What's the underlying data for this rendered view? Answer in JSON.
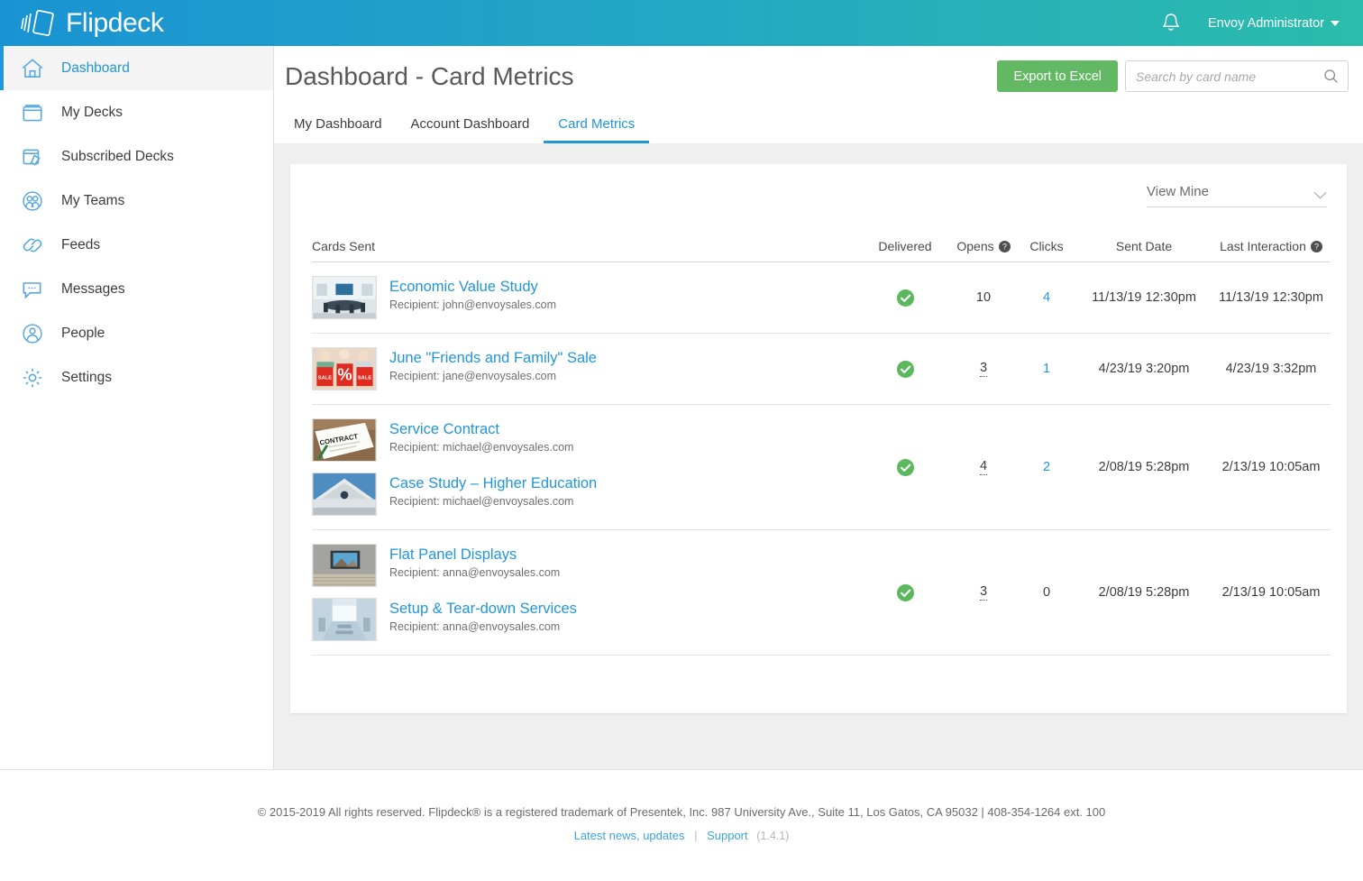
{
  "app": {
    "brand": "Flipdeck",
    "user": "Envoy Administrator",
    "bell_icon": "bell-icon",
    "logo_icon": "flipdeck-cards-logo"
  },
  "sidebar": {
    "items": [
      {
        "label": "Dashboard",
        "icon": "home-icon",
        "active": true
      },
      {
        "label": "My Decks",
        "icon": "deck-box-icon",
        "active": false
      },
      {
        "label": "Subscribed Decks",
        "icon": "subscribed-deck-icon",
        "active": false
      },
      {
        "label": "My Teams",
        "icon": "team-icon",
        "active": false
      },
      {
        "label": "Feeds",
        "icon": "link-chain-icon",
        "active": false
      },
      {
        "label": "Messages",
        "icon": "message-bubble-icon",
        "active": false
      },
      {
        "label": "People",
        "icon": "person-icon",
        "active": false
      },
      {
        "label": "Settings",
        "icon": "gear-icon",
        "active": false
      }
    ]
  },
  "page": {
    "title": "Dashboard - Card Metrics",
    "export_label": "Export to Excel",
    "search_placeholder": "Search by card name",
    "search_value": ""
  },
  "tabs": [
    {
      "label": "My Dashboard",
      "active": false
    },
    {
      "label": "Account Dashboard",
      "active": false
    },
    {
      "label": "Card Metrics",
      "active": true
    }
  ],
  "filter": {
    "view_label": "View Mine",
    "chevron_icon": "chevron-down-icon"
  },
  "table": {
    "headers": {
      "cards_sent": "Cards Sent",
      "delivered": "Delivered",
      "opens": "Opens",
      "clicks": "Clicks",
      "sent_date": "Sent Date",
      "last_interaction": "Last Interaction"
    },
    "groups": [
      {
        "cards": [
          {
            "title": "Economic Value Study",
            "recipient": "Recipient: john@envoysales.com",
            "thumb": "conference-room-photo"
          }
        ],
        "delivered": true,
        "opens": "10",
        "opens_dotted": false,
        "clicks": "4",
        "clicks_link": true,
        "sent_date": "11/13/19 12:30pm",
        "last_interaction": "11/13/19 12:30pm"
      },
      {
        "cards": [
          {
            "title": "June \"Friends and Family\" Sale",
            "recipient": "Recipient: jane@envoysales.com",
            "thumb": "sale-shopping-bags-photo"
          }
        ],
        "delivered": true,
        "opens": "3",
        "opens_dotted": true,
        "clicks": "1",
        "clicks_link": true,
        "sent_date": "4/23/19 3:20pm",
        "last_interaction": "4/23/19 3:32pm"
      },
      {
        "cards": [
          {
            "title": "Service Contract",
            "recipient": "Recipient: michael@envoysales.com",
            "thumb": "contract-document-photo"
          },
          {
            "title": "Case Study – Higher Education",
            "recipient": "Recipient: michael@envoysales.com",
            "thumb": "university-building-photo"
          }
        ],
        "delivered": true,
        "opens": "4",
        "opens_dotted": true,
        "clicks": "2",
        "clicks_link": true,
        "sent_date": "2/08/19 5:28pm",
        "last_interaction": "2/13/19 10:05am"
      },
      {
        "cards": [
          {
            "title": "Flat Panel Displays",
            "recipient": "Recipient: anna@envoysales.com",
            "thumb": "flat-panel-tv-photo"
          },
          {
            "title": "Setup & Tear-down Services",
            "recipient": "Recipient: anna@envoysales.com",
            "thumb": "event-hall-photo"
          }
        ],
        "delivered": true,
        "opens": "3",
        "opens_dotted": true,
        "clicks": "0",
        "clicks_link": false,
        "sent_date": "2/08/19 5:28pm",
        "last_interaction": "2/13/19 10:05am"
      }
    ]
  },
  "footer": {
    "copyright": "© 2015-2019 All rights reserved. Flipdeck® is a registered trademark of Presentek, Inc. 987 University Ave., Suite 11, Los Gatos, CA  95032 | 408-354-1264 ext. 100",
    "news_link": "Latest news, updates",
    "separator": "|",
    "support_link": "Support",
    "version": "(1.4.1)"
  },
  "colors": {
    "brand_blue": "#1a93d2",
    "brand_teal": "#2bbcab",
    "link": "#2196d8",
    "export_green": "#63b863",
    "delivered_green": "#5cb85c"
  }
}
